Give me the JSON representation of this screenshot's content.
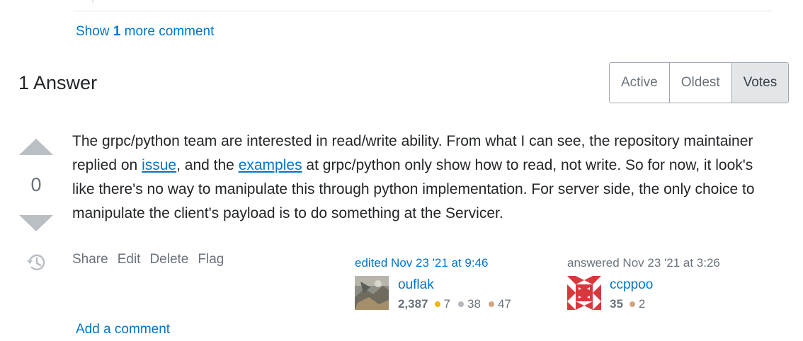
{
  "comments": {
    "show_more_prefix": "Show",
    "show_more_count": "1",
    "show_more_suffix": "more comment"
  },
  "answers_header": {
    "title": "1 Answer",
    "sort_tabs": [
      {
        "label": "Active",
        "selected": false
      },
      {
        "label": "Oldest",
        "selected": false
      },
      {
        "label": "Votes",
        "selected": true
      }
    ]
  },
  "answer": {
    "vote_score": "0",
    "body": {
      "part1": "The grpc/python team are interested in read/write ability. From what I can see, the repository maintainer replied on ",
      "link1": "issue",
      "part2": ", and the ",
      "link2": "examples",
      "part3": " at grpc/python only show how to read, not write. So for now, it look's like there's no way to manipulate this through python implementation. For server side, the only choice to manipulate the client's payload is to do something at the Servicer."
    },
    "actions": [
      "Share",
      "Edit",
      "Delete",
      "Flag"
    ],
    "edited": {
      "label": "edited Nov 23 '21 at 9:46",
      "user": "ouflak",
      "reputation": "2,387",
      "gold": "7",
      "silver": "38",
      "bronze": "47"
    },
    "answered": {
      "label": "answered Nov 23 '21 at 3:26",
      "user": "ccppoo",
      "reputation": "35",
      "bronze": "2"
    },
    "add_comment": "Add a comment"
  },
  "colors": {
    "link": "#0074cc",
    "text": "#232629",
    "muted": "#6a737c",
    "gold": "#f1b600",
    "silver": "#b4b8bc",
    "bronze": "#d1a684"
  }
}
